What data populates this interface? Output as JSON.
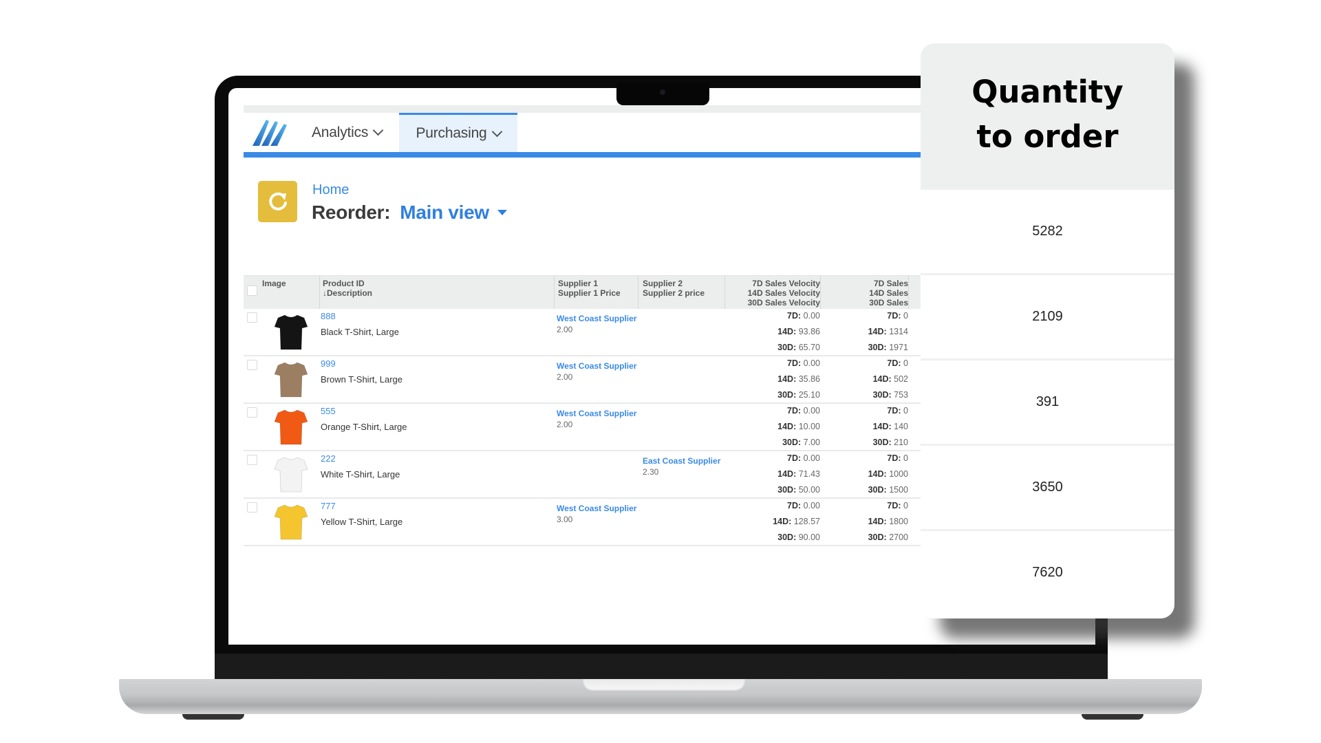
{
  "nav": {
    "logo": "logo-icon",
    "items": [
      {
        "label": "Analytics",
        "icon": "chevron-down-icon",
        "active": false
      },
      {
        "label": "Purchasing",
        "icon": "chevron-down-icon",
        "active": true
      }
    ],
    "accent_color": "#3a8ae6"
  },
  "page": {
    "breadcrumb": "Home",
    "title_label": "Reorder:",
    "view_name": "Main view",
    "view_icon": "caret-down-icon",
    "page_icon": "refresh-icon",
    "page_icon_color": "#e4bd3c"
  },
  "table": {
    "headers": {
      "image": "Image",
      "product_id": "Product ID",
      "description": "↓Description",
      "supplier1": "Supplier 1",
      "supplier1_price": "Supplier 1 Price",
      "supplier2": "Supplier 2",
      "supplier2_price": "Supplier 2 price",
      "vel7": "7D Sales Velocity",
      "vel14": "14D Sales Velocity",
      "vel30": "30D Sales Velocity",
      "sales7": "7D Sales",
      "sales14": "14D Sales",
      "sales30": "30D Sales"
    },
    "metric_labels": {
      "d7": "7D:",
      "d14": "14D:",
      "d30": "30D:"
    },
    "rows": [
      {
        "id": "888",
        "description": "Black T-Shirt, Large",
        "shirt_color": "#141414",
        "supplier1": "West Coast Supplier",
        "supplier1_price": "2.00",
        "supplier2": "",
        "supplier2_price": "",
        "vel7": "0.00",
        "vel14": "93.86",
        "vel30": "65.70",
        "sales7": "0",
        "sales14": "1314",
        "sales30": "1971"
      },
      {
        "id": "999",
        "description": "Brown T-Shirt, Large",
        "shirt_color": "#9c7f62",
        "supplier1": "West Coast Supplier",
        "supplier1_price": "2.00",
        "supplier2": "",
        "supplier2_price": "",
        "vel7": "0.00",
        "vel14": "35.86",
        "vel30": "25.10",
        "sales7": "0",
        "sales14": "502",
        "sales30": "753"
      },
      {
        "id": "555",
        "description": "Orange T-Shirt, Large",
        "shirt_color": "#f05a14",
        "supplier1": "West Coast Supplier",
        "supplier1_price": "2.00",
        "supplier2": "",
        "supplier2_price": "",
        "vel7": "0.00",
        "vel14": "10.00",
        "vel30": "7.00",
        "sales7": "0",
        "sales14": "140",
        "sales30": "210"
      },
      {
        "id": "222",
        "description": "White T-Shirt, Large",
        "shirt_color": "#f3f3f3",
        "supplier1": "",
        "supplier1_price": "",
        "supplier2": "East Coast Supplier",
        "supplier2_price": "2.30",
        "vel7": "0.00",
        "vel14": "71.43",
        "vel30": "50.00",
        "sales7": "0",
        "sales14": "1000",
        "sales30": "1500"
      },
      {
        "id": "777",
        "description": "Yellow T-Shirt, Large",
        "shirt_color": "#f5c52f",
        "supplier1": "West Coast Supplier",
        "supplier1_price": "3.00",
        "supplier2": "",
        "supplier2_price": "",
        "vel7": "0.00",
        "vel14": "128.57",
        "vel30": "90.00",
        "sales7": "0",
        "sales14": "1800",
        "sales30": "2700"
      }
    ]
  },
  "quantity_card": {
    "title": "Quantity to order",
    "values": [
      "5282",
      "2109",
      "391",
      "3650",
      "7620"
    ]
  }
}
